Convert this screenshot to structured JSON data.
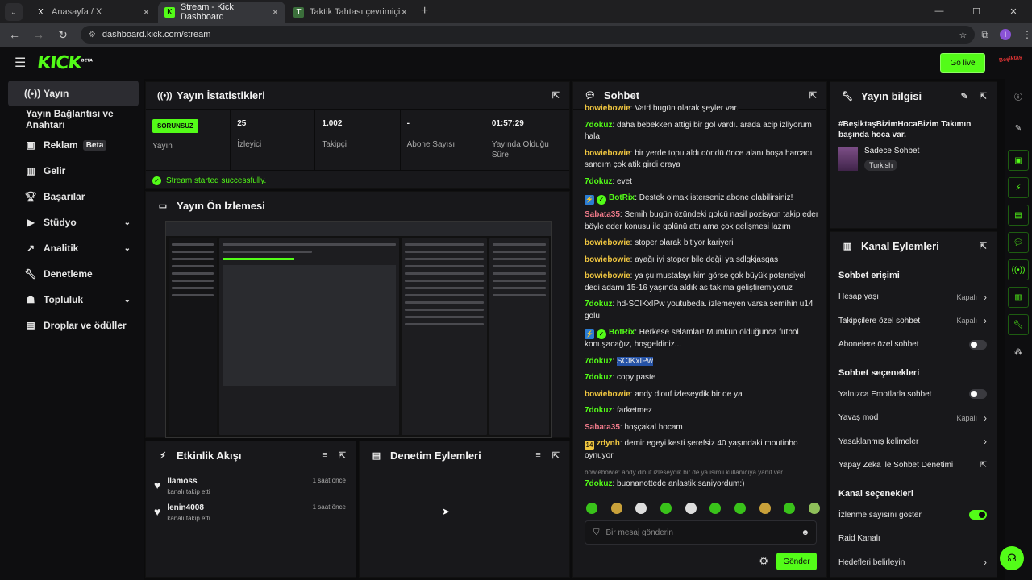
{
  "browser": {
    "tabs": [
      {
        "title": "Anasayfa / X",
        "icon": "X",
        "active": false
      },
      {
        "title": "Stream - Kick Dashboard",
        "icon": "K",
        "active": true
      },
      {
        "title": "Taktik Tahtası çevrimiçi – Futbol",
        "icon": "T",
        "active": false
      }
    ],
    "url": "dashboard.kick.com/stream",
    "profile_initial": "I"
  },
  "header": {
    "logo": "KICK",
    "logo_sup": "BETA",
    "go_live": "Go live",
    "badge_text": "Beşiktaş"
  },
  "sidebar": {
    "items": [
      {
        "label": "Yayın",
        "icon": "broadcast-icon"
      },
      {
        "label": "Yayın Bağlantısı ve Anahtarı",
        "icon": ""
      },
      {
        "label": "Reklam",
        "icon": "ads-icon",
        "badge": "Beta"
      },
      {
        "label": "Gelir",
        "icon": "revenue-icon"
      },
      {
        "label": "Başarılar",
        "icon": "trophy-icon"
      },
      {
        "label": "Stüdyo",
        "icon": "studio-icon"
      },
      {
        "label": "Analitik",
        "icon": "analytics-icon"
      },
      {
        "label": "Denetleme",
        "icon": "wrench-icon"
      },
      {
        "label": "Topluluk",
        "icon": "community-icon"
      },
      {
        "label": "Droplar ve ödüller",
        "icon": "drops-icon"
      }
    ]
  },
  "stats_panel": {
    "title": "Yayın İstatistikleri",
    "status": "SORUNSUZ",
    "status_label": "Yayın",
    "items": [
      {
        "value": "25",
        "label": "İzleyici"
      },
      {
        "value": "1.002",
        "label": "Takipçi"
      },
      {
        "value": "-",
        "label": "Abone Sayısı"
      },
      {
        "value": "01:57:29",
        "label": "Yayında Olduğu Süre"
      }
    ],
    "success": "Stream started successfully."
  },
  "preview_panel": {
    "title": "Yayın Ön İzlemesi"
  },
  "activity_panel": {
    "title": "Etkinlik Akışı",
    "items": [
      {
        "name": "llamoss",
        "desc": "kanalı takip etti",
        "time": "1 saat önce"
      },
      {
        "name": "lenin4008",
        "desc": "kanalı takip etti",
        "time": "1 saat önce"
      }
    ]
  },
  "moderation_panel": {
    "title": "Denetim Eylemleri"
  },
  "chat": {
    "title": "Sohbet",
    "messages": [
      {
        "user": "bowiebowie",
        "color": "#f0c640",
        "text": "Vatd bugün olarak şeyler var."
      },
      {
        "user": "7dokuz",
        "color": "#53fc18",
        "text": "daha bebekken attigi bir gol vardı. arada acip izliyorum hala"
      },
      {
        "user": "bowiebowie",
        "color": "#f0c640",
        "text": "bir yerde topu aldı döndü önce alanı boşa harcadı sandım çok atik girdi oraya"
      },
      {
        "user": "7dokuz",
        "color": "#53fc18",
        "text": "evet"
      },
      {
        "user": "BotRix",
        "color": "#53fc18",
        "text": "Destek olmak isterseniz abone olabilirsiniz!",
        "bot": true
      },
      {
        "user": "Sabata35",
        "color": "#f07a8a",
        "text": "Semih bugün özündeki golcü nasil pozisyon takip eder böyle eder konusu ile golünü attı ama çok gelişmesi lazım"
      },
      {
        "user": "bowiebowie",
        "color": "#f0c640",
        "text": "stoper olarak bitiyor kariyeri"
      },
      {
        "user": "bowiebowie",
        "color": "#f0c640",
        "text": "ayağı iyi stoper bile değil ya sdlgkjasgas"
      },
      {
        "user": "bowiebowie",
        "color": "#f0c640",
        "text": "ya şu mustafayı kim görse çok büyük potansiyel dedi adamı 15-16 yaşında aldık as takıma geliştiremiyoruz"
      },
      {
        "user": "7dokuz",
        "color": "#53fc18",
        "text": "hd-SCIKxIPw youtubeda. izlemeyen varsa semihin u14 golu"
      },
      {
        "user": "BotRix",
        "color": "#53fc18",
        "text": "Herkese selamlar! Mümkün olduğunca futbol konuşacağız, hoşgeldiniz...",
        "bot": true
      },
      {
        "user": "7dokuz",
        "color": "#53fc18",
        "text": "SCIKxIPw",
        "highlight": true
      },
      {
        "user": "7dokuz",
        "color": "#53fc18",
        "text": "copy paste"
      },
      {
        "user": "bowiebowie",
        "color": "#f0c640",
        "text": "andy diouf izleseydik bir de ya"
      },
      {
        "user": "7dokuz",
        "color": "#53fc18",
        "text": "farketmez"
      },
      {
        "user": "Sabata35",
        "color": "#f07a8a",
        "text": "hoşçakal hocam"
      },
      {
        "user": "zdynh",
        "color": "#f0c640",
        "text": "demir egeyi kesti şerefsiz 40 yaşındaki moutinho oynuyor",
        "sub": "14"
      },
      {
        "user": "7dokuz",
        "color": "#53fc18",
        "text": "buonanottede anlastik saniyordum:)",
        "reply": "bowiebowie: andy diouf izleseydik bir de ya isimli kullanıcıya yanıt ver..."
      }
    ],
    "input_placeholder": "Bir mesaj gönderin",
    "send": "Gönder"
  },
  "stream_info": {
    "title": "Yayın bilgisi",
    "stream_title": "#BeşiktaşBizimHocaBizim Takımın başında hoca var.",
    "category": "Sadece Sohbet",
    "language": "Turkish"
  },
  "channel_actions": {
    "title": "Kanal Eylemleri",
    "sections": [
      {
        "heading": "Sohbet erişimi",
        "rows": [
          {
            "label": "Hesap yaşı",
            "value": "Kapalı",
            "type": "arrow"
          },
          {
            "label": "Takipçilere özel sohbet",
            "value": "Kapalı",
            "type": "arrow"
          },
          {
            "label": "Abonelere özel sohbet",
            "value": "",
            "type": "toggle-off"
          }
        ]
      },
      {
        "heading": "Sohbet seçenekleri",
        "rows": [
          {
            "label": "Yalnızca Emotlarla sohbet",
            "value": "",
            "type": "toggle-off"
          },
          {
            "label": "Yavaş mod",
            "value": "Kapalı",
            "type": "arrow"
          },
          {
            "label": "Yasaklanmış kelimeler",
            "value": "",
            "type": "arrow"
          },
          {
            "label": "Yapay Zeka ile Sohbet Denetimi",
            "value": "",
            "type": "external"
          }
        ]
      },
      {
        "heading": "Kanal seçenekleri",
        "rows": [
          {
            "label": "İzlenme sayısını göster",
            "value": "",
            "type": "toggle-on"
          },
          {
            "label": "Raid Kanalı",
            "value": "",
            "type": "none"
          },
          {
            "label": "Hedefleri belirleyin",
            "value": "",
            "type": "arrow"
          }
        ]
      }
    ]
  },
  "colors": {
    "accent": "#53fc18",
    "panel": "#18181b",
    "bg": "#0b0b0c"
  }
}
